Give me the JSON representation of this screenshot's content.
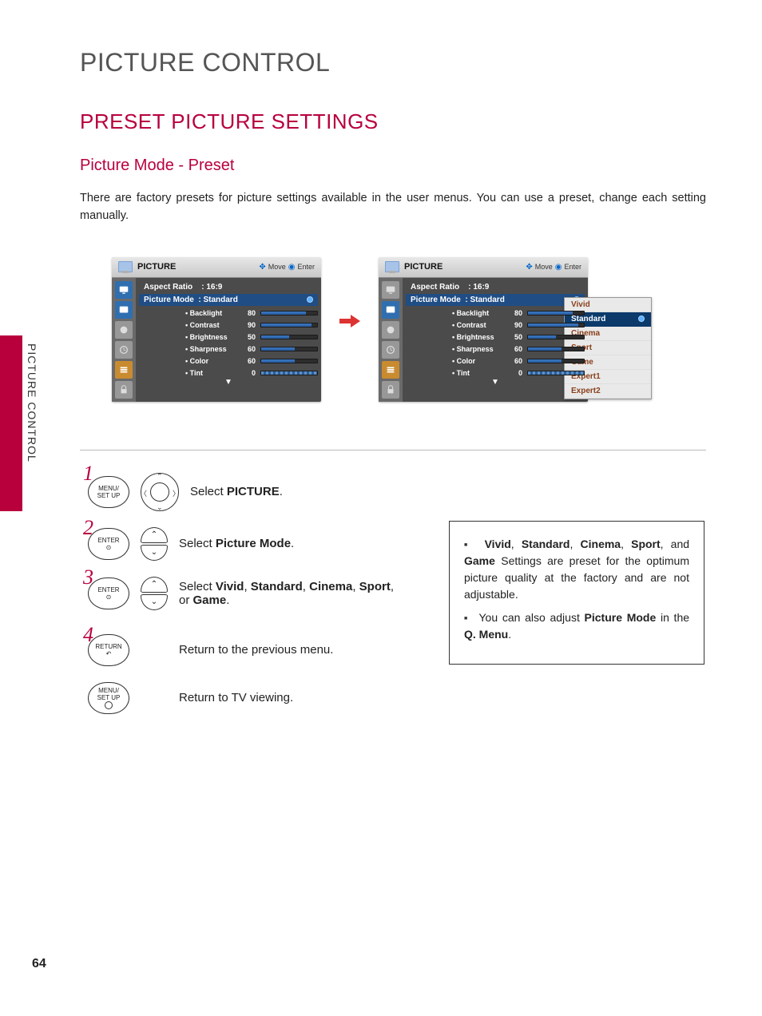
{
  "page_number": "64",
  "side_tab_label": "PICTURE CONTROL",
  "h1": "PICTURE CONTROL",
  "h2": "PRESET PICTURE SETTINGS",
  "h3": "Picture Mode - Preset",
  "intro": "There are factory presets for picture settings available in the user menus. You can use a preset, change each setting manually.",
  "osd": {
    "title": "PICTURE",
    "hint_move": "Move",
    "hint_enter": "Enter",
    "aspect_label": "Aspect Ratio",
    "aspect_value": ": 16:9",
    "mode_label": "Picture Mode",
    "mode_value": ": Standard",
    "params": [
      {
        "label": "• Backlight",
        "value": "80",
        "pct": 80
      },
      {
        "label": "• Contrast",
        "value": "90",
        "pct": 90
      },
      {
        "label": "• Brightness",
        "value": "50",
        "pct": 50
      },
      {
        "label": "• Sharpness",
        "value": "60",
        "pct": 60
      },
      {
        "label": "• Color",
        "value": "60",
        "pct": 60
      },
      {
        "label": "• Tint",
        "value": "0",
        "pct": 50
      }
    ],
    "down_glyph": "▼"
  },
  "dropdown": {
    "options": [
      "Vivid",
      "Standard",
      "Cinema",
      "Sport",
      "Game",
      "Expert1",
      "Expert2"
    ],
    "selected_index": 1
  },
  "steps": {
    "s1_btn": "MENU/\nSET UP",
    "s1_text_a": "Select ",
    "s1_text_b": "PICTURE",
    "s1_text_c": ".",
    "s2_btn": "ENTER",
    "s2_text_a": "Select ",
    "s2_text_b": "Picture Mode",
    "s2_text_c": ".",
    "s3_btn": "ENTER",
    "s3_text_a": "Select ",
    "s3_b1": "Vivid",
    "s3_sep1": ", ",
    "s3_b2": "Standard",
    "s3_sep2": ", ",
    "s3_b3": "Cinema",
    "s3_sep3": ", ",
    "s3_b4": "Sport",
    "s3_sep4": ", or ",
    "s3_b5": "Game",
    "s3_text_c": ".",
    "s4_btn": "RETURN",
    "s4_text": "Return to the previous menu.",
    "s5_btn": "MENU/\nSET UP",
    "s5_text": "Return to TV viewing."
  },
  "notes": {
    "n1_b1": "Vivid",
    "n1_s1": ", ",
    "n1_b2": "Standard",
    "n1_s2": ", ",
    "n1_b3": "Cinema",
    "n1_s3": ", ",
    "n1_b4": "Sport",
    "n1_s4": ", and ",
    "n1_b5": "Game",
    "n1_tail": " Settings are preset for the optimum picture quality at the factory and are not adjustable.",
    "n2_a": "You can also adjust ",
    "n2_b1": "Picture Mode",
    "n2_mid": " in the ",
    "n2_b2": "Q. Menu",
    "n2_c": "."
  }
}
